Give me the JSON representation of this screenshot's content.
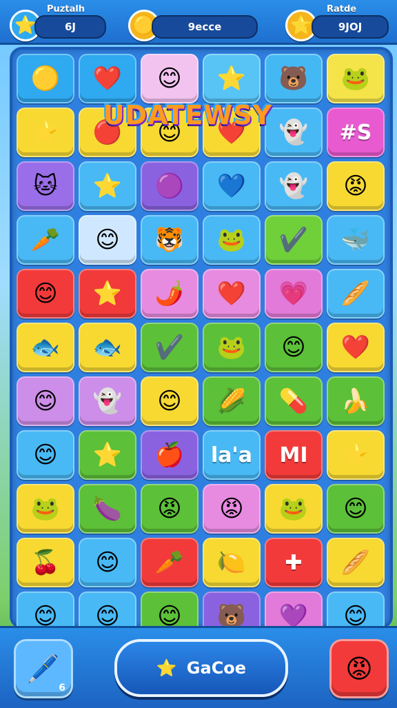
{
  "hud": {
    "left_label": "Puztalh",
    "left_value": "6J",
    "center_value": "9ecce",
    "right_label": "Ratde",
    "right_value": "9JOJ",
    "left_icon": "star-coin-icon",
    "center_icon": "gold-coin-icon",
    "right_icon": "star-coin-icon"
  },
  "banner": {
    "text": "UDATEWSY"
  },
  "bottom": {
    "main_label": "GaCoe",
    "main_icon": "star-icon",
    "tool_badge": "6",
    "tool_icon": "pencil-icon",
    "face_icon": "red-face-icon"
  },
  "tiles": [
    {
      "glyph": "🟡",
      "name": "yellow-orb-icon",
      "color": "#2fa9f0"
    },
    {
      "glyph": "❤️",
      "name": "heart-icon",
      "color": "#2fa9f0"
    },
    {
      "glyph": "😊",
      "name": "pink-face-icon",
      "color": "#f3c3f0"
    },
    {
      "glyph": "⭐",
      "name": "star-icon",
      "color": "#58c3f5"
    },
    {
      "glyph": "🐻",
      "name": "red-bear-icon",
      "color": "#44b8f3"
    },
    {
      "glyph": "🐸",
      "name": "green-frog-icon",
      "color": "#f5e34a"
    },
    {
      "glyph": "⭐",
      "name": "star-icon",
      "color": "#f7d932"
    },
    {
      "glyph": "🔴",
      "name": "red-ball-icon",
      "color": "#f7d932"
    },
    {
      "glyph": "😊",
      "name": "blue-face-icon",
      "color": "#f7d932"
    },
    {
      "glyph": "❤️",
      "name": "heart-icon",
      "color": "#f7d932"
    },
    {
      "glyph": "👻",
      "name": "ghost-icon",
      "color": "#48b9f5"
    },
    {
      "glyph": "🐱",
      "name": "cat-face-icon",
      "color": "#9a6ee8"
    },
    {
      "glyph": "⭐",
      "name": "star-face-icon",
      "color": "#48b9f5"
    },
    {
      "glyph": "🟣",
      "name": "purple-orb-icon",
      "color": "#8a62e0"
    },
    {
      "glyph": "💙",
      "name": "blue-heart-icon",
      "color": "#48b9f5"
    },
    {
      "glyph": "👻",
      "name": "ghost-icon",
      "color": "#48b9f5"
    },
    {
      "glyph": "😡",
      "name": "red-face-icon",
      "color": "#f7d932"
    },
    {
      "glyph": "🥕",
      "name": "carrot-icon",
      "color": "#48b9f5"
    },
    {
      "glyph": "😊",
      "name": "blue-face-icon",
      "color": "#cfe8ff"
    },
    {
      "glyph": "🐯",
      "name": "tiger-face-icon",
      "color": "#48b9f5"
    },
    {
      "glyph": "🐸",
      "name": "green-frog-icon",
      "color": "#48b9f5"
    },
    {
      "glyph": "✔️",
      "name": "check-icon",
      "color": "#6fd03a"
    },
    {
      "glyph": "🐳",
      "name": "whale-icon",
      "color": "#48b9f5"
    },
    {
      "glyph": "😊",
      "name": "red-face-icon",
      "color": "#f23a3a"
    },
    {
      "glyph": "⭐",
      "name": "star-icon",
      "color": "#f23a3a"
    },
    {
      "glyph": "🌶️",
      "name": "chili-icon",
      "color": "#e78be0"
    },
    {
      "glyph": "❤️",
      "name": "heart-icon",
      "color": "#e78be0"
    },
    {
      "glyph": "💗",
      "name": "pink-heart-icon",
      "color": "#e27ad9"
    },
    {
      "glyph": "🥖",
      "name": "stick-icon",
      "color": "#48b9f5"
    },
    {
      "glyph": "🐟",
      "name": "fish-icon",
      "color": "#f7d932"
    },
    {
      "glyph": "🐟",
      "name": "fish-icon",
      "color": "#f7d932"
    },
    {
      "glyph": "✔️",
      "name": "check-icon",
      "color": "#5cc038"
    },
    {
      "glyph": "🐸",
      "name": "frog-face-icon",
      "color": "#5cc038"
    },
    {
      "glyph": "😊",
      "name": "green-face-icon",
      "color": "#5cc038"
    },
    {
      "glyph": "❤️",
      "name": "heart-icon",
      "color": "#f7d932"
    },
    {
      "glyph": "😊",
      "name": "purple-face-icon",
      "color": "#cc8ee8"
    },
    {
      "glyph": "👻",
      "name": "ghost-icon",
      "color": "#cc8ee8"
    },
    {
      "glyph": "😊",
      "name": "yellow-face-icon",
      "color": "#f7d932"
    },
    {
      "glyph": "🌽",
      "name": "veggie-icon",
      "color": "#5cc038"
    },
    {
      "glyph": "💊",
      "name": "green-capsule-icon",
      "color": "#5cc038"
    },
    {
      "glyph": "🍌",
      "name": "banana-icon",
      "color": "#5cc038"
    },
    {
      "glyph": "😊",
      "name": "blue-face-icon",
      "color": "#48b9f5"
    },
    {
      "glyph": "⭐",
      "name": "grey-star-icon",
      "color": "#5cc038"
    },
    {
      "glyph": "🍎",
      "name": "apple-icon",
      "color": "#8a62e0"
    },
    {
      "glyph": "⭐",
      "name": "star-icon",
      "color": "#f7d932"
    },
    {
      "glyph": "🐸",
      "name": "frog-face-icon",
      "color": "#f7d932"
    },
    {
      "glyph": "🍆",
      "name": "purple-stick-icon",
      "color": "#5cc038"
    },
    {
      "glyph": "😡",
      "name": "red-face-icon",
      "color": "#5cc038"
    },
    {
      "glyph": "😡",
      "name": "red-face-icon",
      "color": "#e78be0"
    },
    {
      "glyph": "🐸",
      "name": "green-frog-icon",
      "color": "#f7d932"
    },
    {
      "glyph": "😊",
      "name": "green-face-icon",
      "color": "#5cc038"
    },
    {
      "glyph": "🍒",
      "name": "cherry-icon",
      "color": "#f7d932"
    },
    {
      "glyph": "😊",
      "name": "blue-face-icon",
      "color": "#48b9f5"
    },
    {
      "glyph": "🥕",
      "name": "carrot-icon",
      "color": "#f23a3a"
    },
    {
      "glyph": "🍋",
      "name": "lemon-icon",
      "color": "#f7d932"
    },
    {
      "glyph": "🥖",
      "name": "stick-icon",
      "color": "#f7d932"
    },
    {
      "glyph": "😊",
      "name": "yellow-face-icon",
      "color": "#48b9f5"
    },
    {
      "glyph": "😊",
      "name": "blue-face-icon",
      "color": "#48b9f5"
    },
    {
      "glyph": "😊",
      "name": "green-face-icon",
      "color": "#5cc038"
    },
    {
      "glyph": "🐻",
      "name": "bear-face-icon",
      "color": "#8a62e0"
    },
    {
      "glyph": "💜",
      "name": "purple-heart-icon",
      "color": "#e27ad9"
    },
    {
      "glyph": "😊",
      "name": "yellow-face-icon",
      "color": "#48b9f5"
    },
    {
      "glyph": "👻",
      "name": "ghost-icon",
      "color": "#f7d932"
    },
    {
      "glyph": "👻",
      "name": "ghost-icon",
      "color": "#f23a3a"
    },
    {
      "glyph": "💊",
      "name": "green-capsule-icon",
      "color": "#48b9f5"
    },
    {
      "glyph": "⭐",
      "name": "star-icon",
      "color": "#5cc038"
    },
    {
      "glyph": "🥚",
      "name": "yellow-egg-icon",
      "color": "#5cc038"
    },
    {
      "glyph": "😊",
      "name": "yellow-face-icon",
      "color": "#f3c3f0"
    },
    {
      "glyph": "💜",
      "name": "purple-heart-icon",
      "color": "#f3c3f0"
    },
    {
      "glyph": "🖊️",
      "name": "white-stick-icon",
      "color": "#f7d932"
    },
    {
      "glyph": "🥕",
      "name": "carrot-icon",
      "color": "#f23a3a"
    }
  ],
  "special_tiles": [
    {
      "text": "#S",
      "name": "hash-s-tile",
      "color": "#e85ad0"
    },
    {
      "text": "la'a",
      "name": "lala-tile",
      "color": "#48b9f5"
    },
    {
      "text": "MI",
      "name": "mi-tile",
      "color": "#f23a3a"
    },
    {
      "text": "✚",
      "name": "plus-tile",
      "color": "#f23a3a"
    }
  ]
}
